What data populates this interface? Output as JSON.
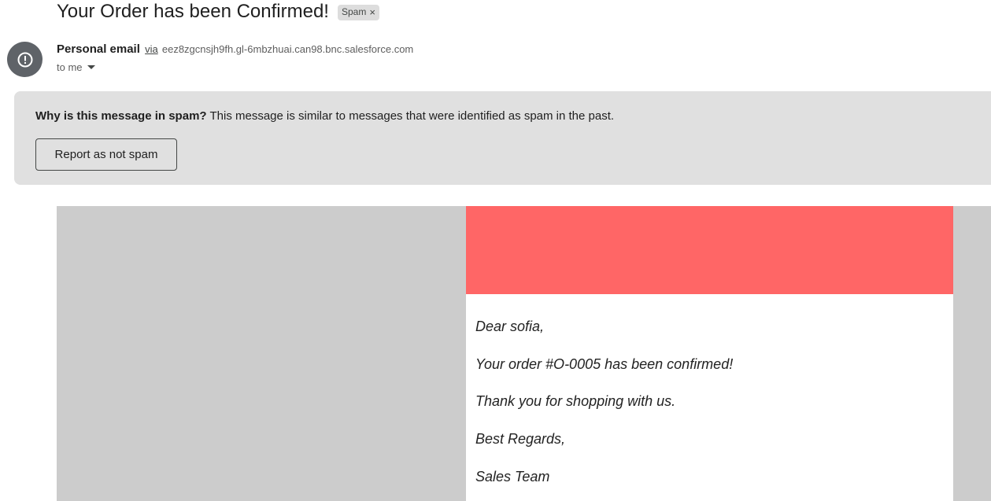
{
  "email": {
    "subject": "Your Order has been Confirmed!",
    "label_chip": "Spam",
    "label_chip_close": "×",
    "sender_name": "Personal email",
    "via_text": "via",
    "sender_domain": "eez8zgcnsjh9fh.gl-6mbzhuai.can98.bnc.salesforce.com",
    "to_text": "to me",
    "avatar_icon": "alert-circle-icon"
  },
  "spam_banner": {
    "question": "Why is this message in spam?",
    "explanation": "This message is similar to messages that were identified as spam in the past.",
    "report_button": "Report as not spam"
  },
  "body": {
    "greeting": "Dear sofia,",
    "order_line": "Your order #O-0005 has been confirmed!",
    "thanks_line": "Thank you for shopping with us.",
    "closing": "Best Regards,",
    "signature": "Sales Team"
  },
  "colors": {
    "header_band": "#ff6666",
    "canvas_background": "#cccccc",
    "banner_background": "#e0e0e0"
  }
}
